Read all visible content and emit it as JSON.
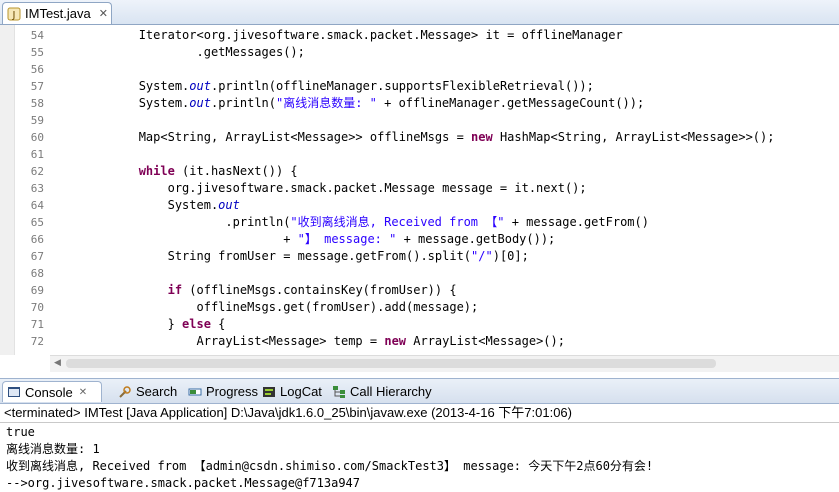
{
  "editor_tab": {
    "label": "IMTest.java"
  },
  "code_lines": [
    {
      "n": "54",
      "t": "            Iterator<org.jivesoftware.smack.packet.Message> it = offlineManager"
    },
    {
      "n": "55",
      "t": "                    .getMessages();"
    },
    {
      "n": "56",
      "t": ""
    },
    {
      "n": "57",
      "t": "            System.out.println(offlineManager.supportsFlexibleRetrieval());"
    },
    {
      "n": "58",
      "t": "            System.out.println(\"离线消息数量: \" + offlineManager.getMessageCount());"
    },
    {
      "n": "59",
      "t": ""
    },
    {
      "n": "60",
      "t": "            Map<String, ArrayList<Message>> offlineMsgs = new HashMap<String, ArrayList<Message>>();"
    },
    {
      "n": "61",
      "t": ""
    },
    {
      "n": "62",
      "t": "            while (it.hasNext()) {"
    },
    {
      "n": "63",
      "t": "                org.jivesoftware.smack.packet.Message message = it.next();"
    },
    {
      "n": "64",
      "t": "                System.out"
    },
    {
      "n": "65",
      "t": "                        .println(\"收到离线消息, Received from 【\" + message.getFrom()"
    },
    {
      "n": "66",
      "t": "                                + \"】 message: \" + message.getBody());"
    },
    {
      "n": "67",
      "t": "                String fromUser = message.getFrom().split(\"/\")[0];"
    },
    {
      "n": "68",
      "t": ""
    },
    {
      "n": "69",
      "t": "                if (offlineMsgs.containsKey(fromUser)) {"
    },
    {
      "n": "70",
      "t": "                    offlineMsgs.get(fromUser).add(message);"
    },
    {
      "n": "71",
      "t": "                } else {"
    },
    {
      "n": "72",
      "t": "                    ArrayList<Message> temp = new ArrayList<Message>();"
    }
  ],
  "console_tabs": [
    {
      "label": "Console",
      "icon": "console-icon"
    },
    {
      "label": "Search",
      "icon": "search-icon"
    },
    {
      "label": "Progress",
      "icon": "progress-icon"
    },
    {
      "label": "LogCat",
      "icon": "logcat-icon"
    },
    {
      "label": "Call Hierarchy",
      "icon": "call-hierarchy-icon"
    }
  ],
  "console_header": "<terminated> IMTest [Java Application] D:\\Java\\jdk1.6.0_25\\bin\\javaw.exe (2013-4-16 下午7:01:06)",
  "console_output": [
    "true",
    "离线消息数量: 1",
    "收到离线消息, Received from 【admin@csdn.shimiso.com/SmackTest3】 message: 今天下午2点60分有会!",
    "-->org.jivesoftware.smack.packet.Message@f713a947"
  ],
  "colors": {
    "keyword": "#7f0055",
    "string": "#2a00ff",
    "field": "#0000c0"
  }
}
